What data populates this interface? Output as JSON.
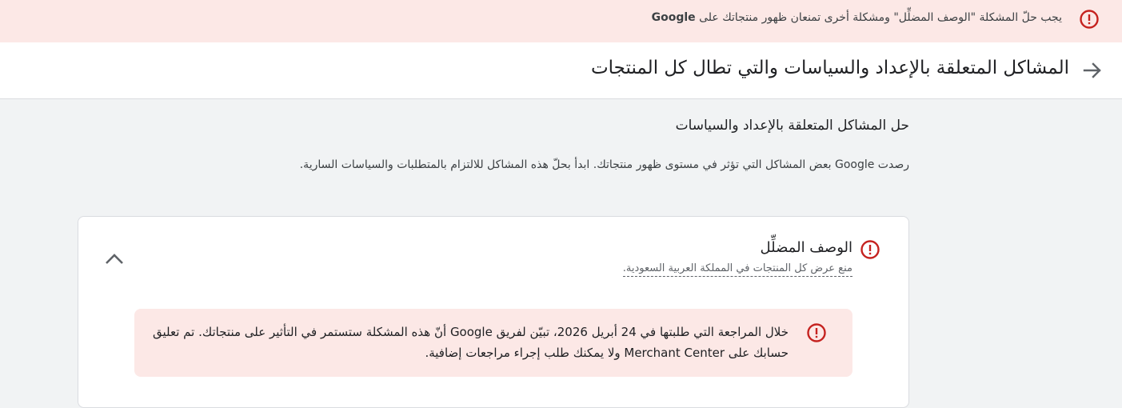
{
  "alert_bar": {
    "message": "يجب حلّ المشكلة \"الوصف المضلِّل\" ومشكلة أخرى تمنعان ظهور منتجاتك على ",
    "brand": "Google",
    "icon": "error-icon",
    "color": "#c5221f"
  },
  "header": {
    "title": "المشاكل المتعلقة بالإعداد والسياسات والتي تطال كل المنتجات",
    "back_icon": "arrow-back-icon"
  },
  "section": {
    "heading": "حل المشاكل المتعلقة بالإعداد والسياسات",
    "description": "رصدت Google بعض المشاكل التي تؤثر في مستوى ظهور منتجاتك. ابدأ بحلّ هذه المشاكل للالتزام بالمتطلبات والسياسات السارية."
  },
  "issue": {
    "title": "الوصف المضلِّل",
    "subtitle": "منع عرض كل المنتجات في المملكة العربية السعودية.",
    "icon": "error-icon",
    "collapse_icon": "chevron-up-icon",
    "review_message": "خلال المراجعة التي طلبتها في 24 أبريل 2026، تبيّن لفريق Google أنّ هذه المشكلة ستستمر في التأثير على منتجاتك. تم تعليق حسابك على Merchant Center ولا يمكنك طلب إجراء مراجعات إضافية."
  },
  "colors": {
    "error_red": "#c5221f",
    "error_bg": "#fce8e6",
    "page_bg": "#f1f3f4"
  }
}
